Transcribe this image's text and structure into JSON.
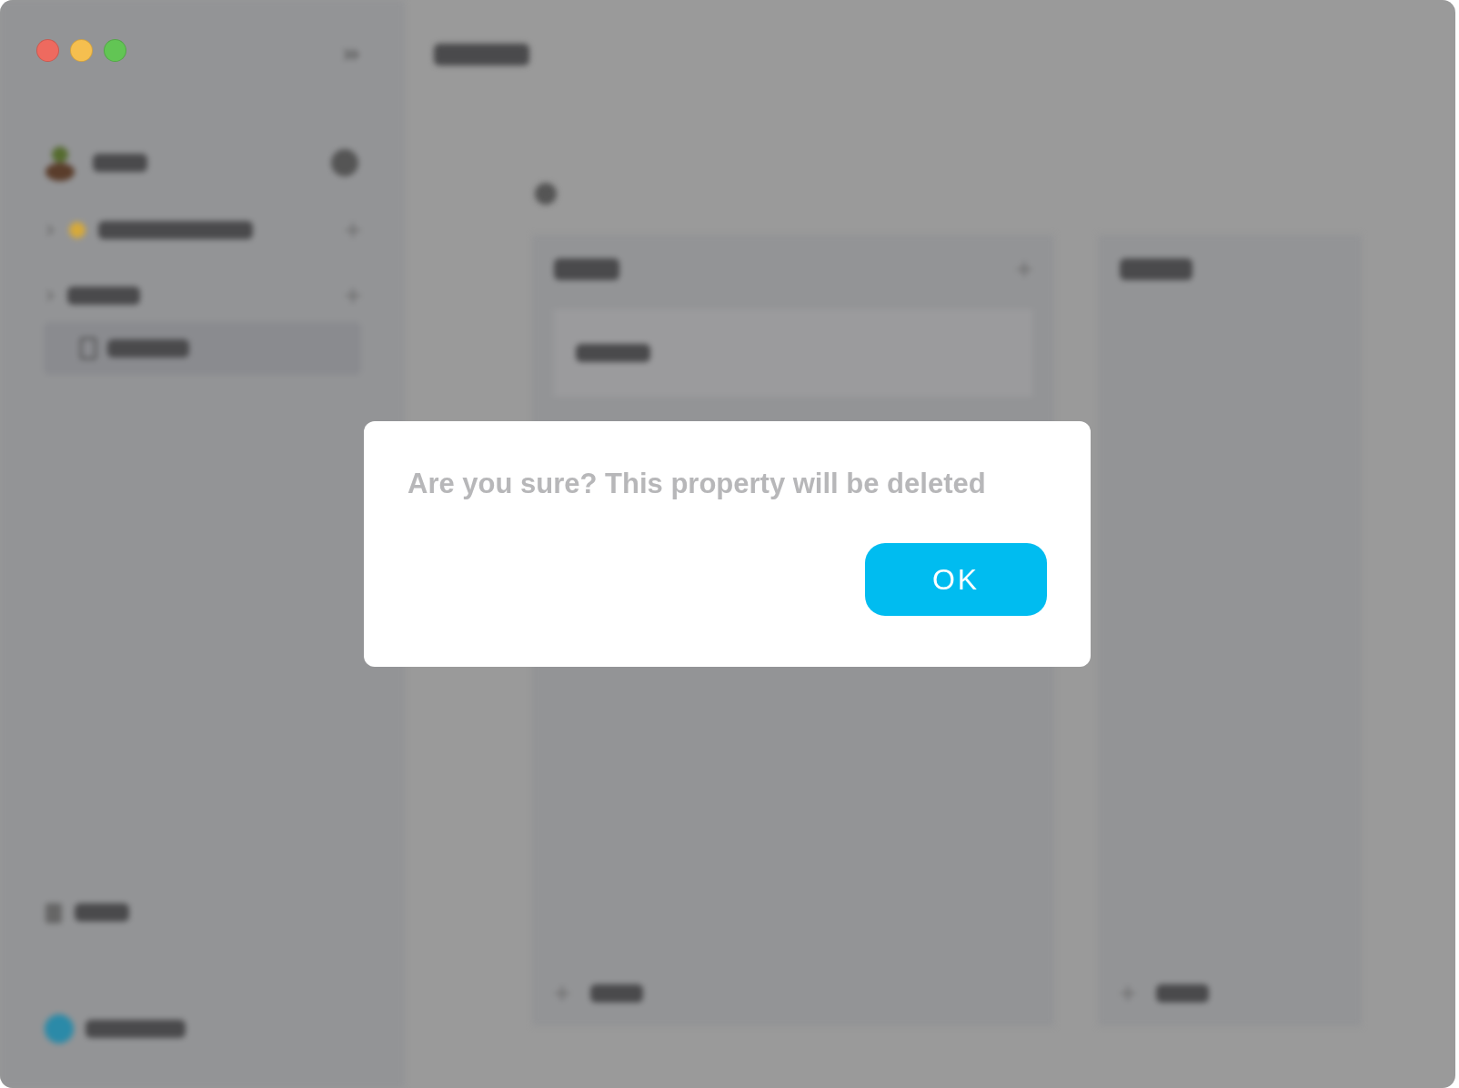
{
  "dialog": {
    "message": "Are you sure? This property will be deleted",
    "button": "OK"
  }
}
